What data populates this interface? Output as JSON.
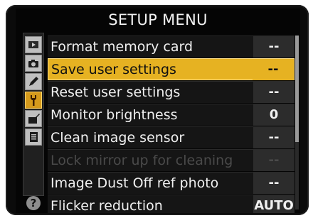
{
  "menu": {
    "title": "SETUP MENU",
    "help_label": "?",
    "items": [
      {
        "label": "Format memory card",
        "value": "--",
        "state": "normal"
      },
      {
        "label": "Save user settings",
        "value": "--",
        "state": "selected"
      },
      {
        "label": "Reset user settings",
        "value": "--",
        "state": "normal"
      },
      {
        "label": "Monitor brightness",
        "value": "0",
        "state": "normal"
      },
      {
        "label": "Clean image sensor",
        "value": "--",
        "state": "normal"
      },
      {
        "label": "Lock mirror up for cleaning",
        "value": "--",
        "state": "disabled"
      },
      {
        "label": "Image Dust Off ref photo",
        "value": "--",
        "state": "normal"
      },
      {
        "label": "Flicker reduction",
        "value": "AUTO",
        "state": "normal"
      }
    ]
  },
  "sidebar": {
    "tabs": [
      {
        "icon": "playback-icon",
        "active": false
      },
      {
        "icon": "camera-icon",
        "active": false
      },
      {
        "icon": "pencil-icon",
        "active": false
      },
      {
        "icon": "wrench-icon",
        "active": true
      },
      {
        "icon": "retouch-icon",
        "active": false
      },
      {
        "icon": "recent-settings-icon",
        "active": false
      }
    ]
  },
  "colors": {
    "accent": "#e6b222",
    "background": "#050505"
  }
}
